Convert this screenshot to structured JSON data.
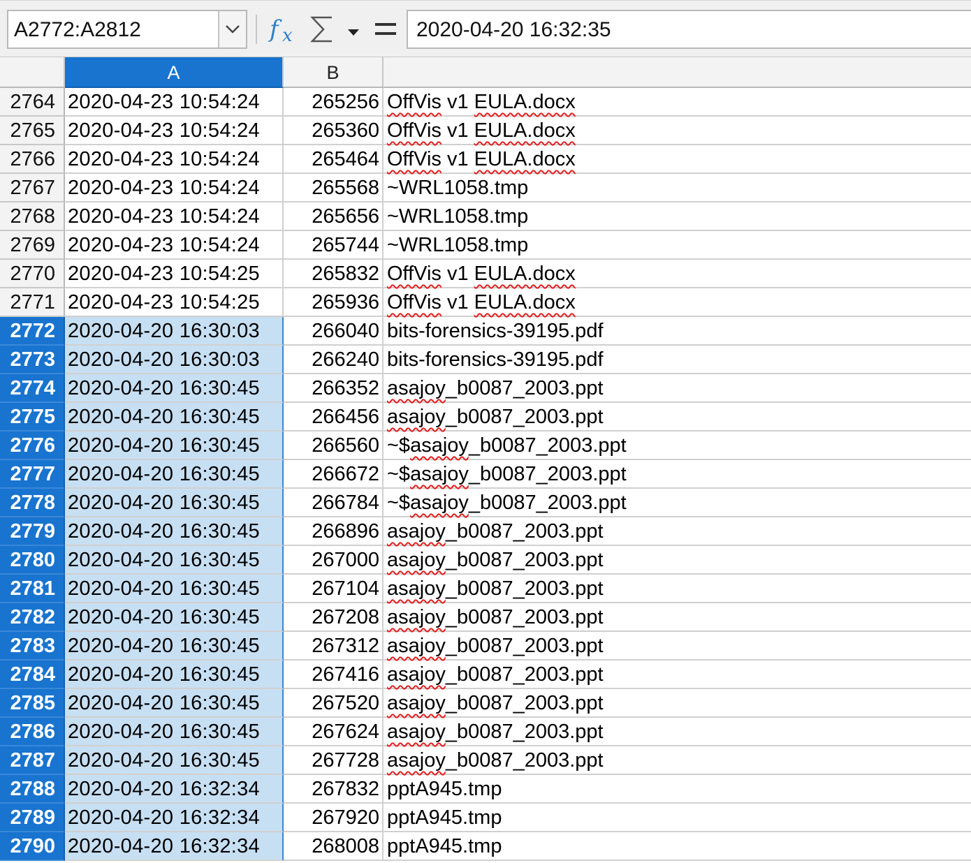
{
  "formula_bar": {
    "name_box_value": "A2772:A2812",
    "formula_value": "2020-04-20 16:32:35",
    "icons": {
      "function_wizard": "fx-icon",
      "sum": "sigma-icon",
      "sum_dropdown": "chevron-down-icon",
      "formula": "equals-icon"
    }
  },
  "column_headers": [
    "A",
    "B"
  ],
  "selected_column": "A",
  "colors": {
    "selection_header": "#1874cf",
    "selection_fill": "#c7dff3",
    "spellcheck_underline": "#e02020"
  },
  "rows": [
    {
      "num": "2764",
      "a": "2020-04-23 10:54:24",
      "b": "265256",
      "c": "OffVis v1 EULA.docx",
      "selected": false
    },
    {
      "num": "2765",
      "a": "2020-04-23 10:54:24",
      "b": "265360",
      "c": "OffVis v1 EULA.docx",
      "selected": false
    },
    {
      "num": "2766",
      "a": "2020-04-23 10:54:24",
      "b": "265464",
      "c": "OffVis v1 EULA.docx",
      "selected": false
    },
    {
      "num": "2767",
      "a": "2020-04-23 10:54:24",
      "b": "265568",
      "c": "~WRL1058.tmp",
      "selected": false
    },
    {
      "num": "2768",
      "a": "2020-04-23 10:54:24",
      "b": "265656",
      "c": "~WRL1058.tmp",
      "selected": false
    },
    {
      "num": "2769",
      "a": "2020-04-23 10:54:24",
      "b": "265744",
      "c": "~WRL1058.tmp",
      "selected": false
    },
    {
      "num": "2770",
      "a": "2020-04-23 10:54:25",
      "b": "265832",
      "c": "OffVis v1 EULA.docx",
      "selected": false
    },
    {
      "num": "2771",
      "a": "2020-04-23 10:54:25",
      "b": "265936",
      "c": "OffVis v1 EULA.docx",
      "selected": false
    },
    {
      "num": "2772",
      "a": "2020-04-20 16:30:03",
      "b": "266040",
      "c": "bits-forensics-39195.pdf",
      "selected": true
    },
    {
      "num": "2773",
      "a": "2020-04-20 16:30:03",
      "b": "266240",
      "c": "bits-forensics-39195.pdf",
      "selected": true
    },
    {
      "num": "2774",
      "a": "2020-04-20 16:30:45",
      "b": "266352",
      "c": "asajoy_b0087_2003.ppt",
      "selected": true
    },
    {
      "num": "2775",
      "a": "2020-04-20 16:30:45",
      "b": "266456",
      "c": "asajoy_b0087_2003.ppt",
      "selected": true
    },
    {
      "num": "2776",
      "a": "2020-04-20 16:30:45",
      "b": "266560",
      "c": "~$asajoy_b0087_2003.ppt",
      "selected": true
    },
    {
      "num": "2777",
      "a": "2020-04-20 16:30:45",
      "b": "266672",
      "c": "~$asajoy_b0087_2003.ppt",
      "selected": true
    },
    {
      "num": "2778",
      "a": "2020-04-20 16:30:45",
      "b": "266784",
      "c": "~$asajoy_b0087_2003.ppt",
      "selected": true
    },
    {
      "num": "2779",
      "a": "2020-04-20 16:30:45",
      "b": "266896",
      "c": "asajoy_b0087_2003.ppt",
      "selected": true
    },
    {
      "num": "2780",
      "a": "2020-04-20 16:30:45",
      "b": "267000",
      "c": "asajoy_b0087_2003.ppt",
      "selected": true
    },
    {
      "num": "2781",
      "a": "2020-04-20 16:30:45",
      "b": "267104",
      "c": "asajoy_b0087_2003.ppt",
      "selected": true
    },
    {
      "num": "2782",
      "a": "2020-04-20 16:30:45",
      "b": "267208",
      "c": "asajoy_b0087_2003.ppt",
      "selected": true
    },
    {
      "num": "2783",
      "a": "2020-04-20 16:30:45",
      "b": "267312",
      "c": "asajoy_b0087_2003.ppt",
      "selected": true
    },
    {
      "num": "2784",
      "a": "2020-04-20 16:30:45",
      "b": "267416",
      "c": "asajoy_b0087_2003.ppt",
      "selected": true
    },
    {
      "num": "2785",
      "a": "2020-04-20 16:30:45",
      "b": "267520",
      "c": "asajoy_b0087_2003.ppt",
      "selected": true
    },
    {
      "num": "2786",
      "a": "2020-04-20 16:30:45",
      "b": "267624",
      "c": "asajoy_b0087_2003.ppt",
      "selected": true
    },
    {
      "num": "2787",
      "a": "2020-04-20 16:30:45",
      "b": "267728",
      "c": "asajoy_b0087_2003.ppt",
      "selected": true
    },
    {
      "num": "2788",
      "a": "2020-04-20 16:32:34",
      "b": "267832",
      "c": "pptA945.tmp",
      "selected": true
    },
    {
      "num": "2789",
      "a": "2020-04-20 16:32:34",
      "b": "267920",
      "c": "pptA945.tmp",
      "selected": true
    },
    {
      "num": "2790",
      "a": "2020-04-20 16:32:34",
      "b": "268008",
      "c": "pptA945.tmp",
      "selected": true
    }
  ]
}
